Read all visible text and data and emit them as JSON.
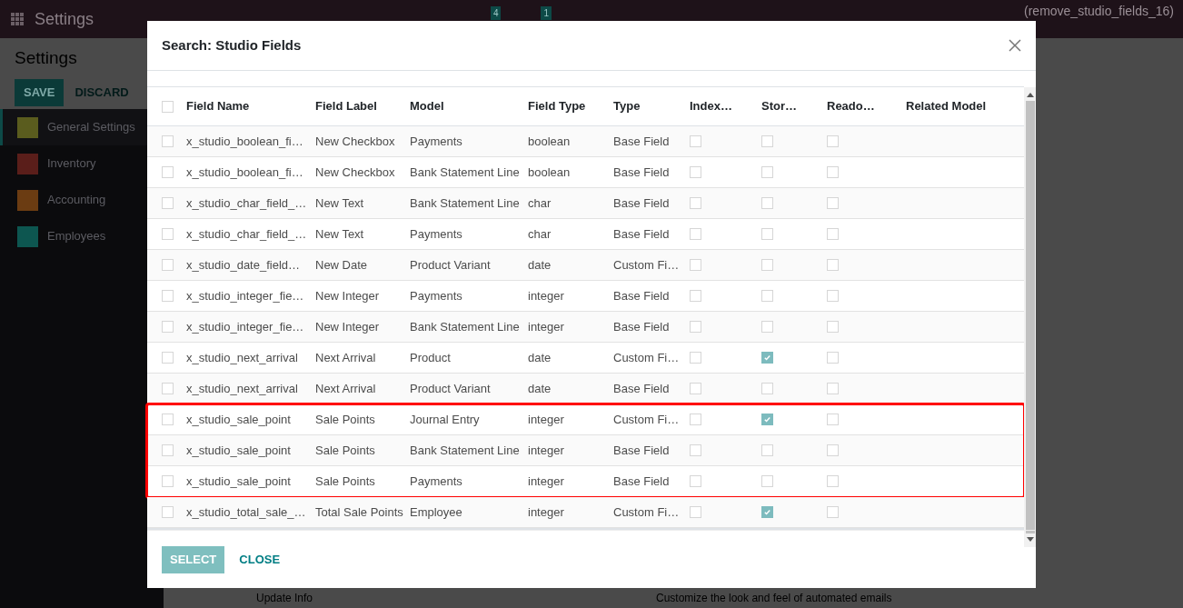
{
  "navbar": {
    "app_title": "Settings",
    "messages_badge": "4",
    "activities_badge": "1",
    "user": "(remove_studio_fields_16)"
  },
  "page": {
    "title": "Settings",
    "buttons": [
      "SAVE",
      "DISCARD"
    ],
    "sidebar": [
      {
        "label": "General Settings",
        "selected": true,
        "color": "#5a5c1e"
      },
      {
        "label": "Inventory",
        "selected": false,
        "color": "#5a1e1a"
      },
      {
        "label": "Accounting",
        "selected": false,
        "color": "#6b3c12"
      },
      {
        "label": "Employees",
        "selected": false,
        "color": "#0d5650"
      }
    ],
    "footer_link": "Update Info",
    "footer_text": "Customize the look and feel of automated emails"
  },
  "dialog": {
    "title": "Search: Studio Fields",
    "select_all_checked": false,
    "columns": [
      "Field Name",
      "Field Label",
      "Model",
      "Field Type",
      "Type",
      "Index…",
      "Stor…",
      "Reado…",
      "Related Model"
    ],
    "rows": [
      {
        "selected": false,
        "name": "x_studio_boolean_fi…",
        "label": "New Checkbox",
        "model": "Payments",
        "field_type": "boolean",
        "type": "Base Field",
        "indexed": false,
        "stored": false,
        "readonly": false,
        "highlighted": false
      },
      {
        "selected": false,
        "name": "x_studio_boolean_fi…",
        "label": "New Checkbox",
        "model": "Bank Statement Line",
        "field_type": "boolean",
        "type": "Base Field",
        "indexed": false,
        "stored": false,
        "readonly": false,
        "highlighted": false
      },
      {
        "selected": false,
        "name": "x_studio_char_field_…",
        "label": "New Text",
        "model": "Bank Statement Line",
        "field_type": "char",
        "type": "Base Field",
        "indexed": false,
        "stored": false,
        "readonly": false,
        "highlighted": false
      },
      {
        "selected": false,
        "name": "x_studio_char_field_…",
        "label": "New Text",
        "model": "Payments",
        "field_type": "char",
        "type": "Base Field",
        "indexed": false,
        "stored": false,
        "readonly": false,
        "highlighted": false
      },
      {
        "selected": false,
        "name": "x_studio_date_field…",
        "label": "New Date",
        "model": "Product Variant",
        "field_type": "date",
        "type": "Custom Fi…",
        "indexed": false,
        "stored": false,
        "readonly": false,
        "highlighted": false
      },
      {
        "selected": false,
        "name": "x_studio_integer_fie…",
        "label": "New Integer",
        "model": "Payments",
        "field_type": "integer",
        "type": "Base Field",
        "indexed": false,
        "stored": false,
        "readonly": false,
        "highlighted": false
      },
      {
        "selected": false,
        "name": "x_studio_integer_fie…",
        "label": "New Integer",
        "model": "Bank Statement Line",
        "field_type": "integer",
        "type": "Base Field",
        "indexed": false,
        "stored": false,
        "readonly": false,
        "highlighted": false
      },
      {
        "selected": false,
        "name": "x_studio_next_arrival",
        "label": "Next Arrival",
        "model": "Product",
        "field_type": "date",
        "type": "Custom Fi…",
        "indexed": false,
        "stored": true,
        "readonly": false,
        "highlighted": false
      },
      {
        "selected": false,
        "name": "x_studio_next_arrival",
        "label": "Next Arrival",
        "model": "Product Variant",
        "field_type": "date",
        "type": "Base Field",
        "indexed": false,
        "stored": false,
        "readonly": false,
        "highlighted": false
      },
      {
        "selected": false,
        "name": "x_studio_sale_point",
        "label": "Sale Points",
        "model": "Journal Entry",
        "field_type": "integer",
        "type": "Custom Fi…",
        "indexed": false,
        "stored": true,
        "readonly": false,
        "highlighted": true
      },
      {
        "selected": false,
        "name": "x_studio_sale_point",
        "label": "Sale Points",
        "model": "Bank Statement Line",
        "field_type": "integer",
        "type": "Base Field",
        "indexed": false,
        "stored": false,
        "readonly": false,
        "highlighted": true
      },
      {
        "selected": false,
        "name": "x_studio_sale_point",
        "label": "Sale Points",
        "model": "Payments",
        "field_type": "integer",
        "type": "Base Field",
        "indexed": false,
        "stored": false,
        "readonly": false,
        "highlighted": true
      },
      {
        "selected": false,
        "name": "x_studio_total_sale_…",
        "label": "Total Sale Points",
        "model": "Employee",
        "field_type": "integer",
        "type": "Custom Fi…",
        "indexed": false,
        "stored": true,
        "readonly": false,
        "highlighted": false
      }
    ],
    "buttons": [
      "SELECT",
      "CLOSE"
    ]
  }
}
